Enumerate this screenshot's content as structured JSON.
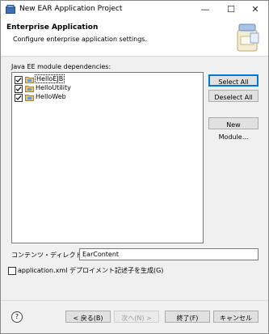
{
  "window": {
    "title": "New EAR Application Project",
    "minimize_glyph": "—",
    "maximize_glyph": "☐",
    "close_glyph": "✕"
  },
  "header": {
    "title": "Enterprise Application",
    "description": "Configure enterprise application settings.",
    "banner_icon": "jar-banner-icon"
  },
  "modules": {
    "label": "Java EE module dependencies:",
    "items": [
      {
        "label": "HelloEJB",
        "checked": true,
        "selected": true
      },
      {
        "label": "HelloUtility",
        "checked": true,
        "selected": false
      },
      {
        "label": "HelloWeb",
        "checked": true,
        "selected": false
      }
    ]
  },
  "side_buttons": {
    "select_all": "Select All",
    "deselect_all": "Deselect All",
    "new_module": "New Module..."
  },
  "content_dir": {
    "label": "コンテンツ・ディレクトリー(C):",
    "value": "EarContent"
  },
  "generate_xml": {
    "label": "application.xml デプロイメント記述子を生成(G)",
    "checked": false
  },
  "footer": {
    "help_glyph": "?",
    "back": "< 戻る(B)",
    "next": "次へ(N) >",
    "finish": "終了(F)",
    "cancel": "キャンセル"
  },
  "colors": {
    "accent": "#0078d7",
    "header_bg": "#ffffff",
    "dialog_bg": "#f0f0f0"
  }
}
